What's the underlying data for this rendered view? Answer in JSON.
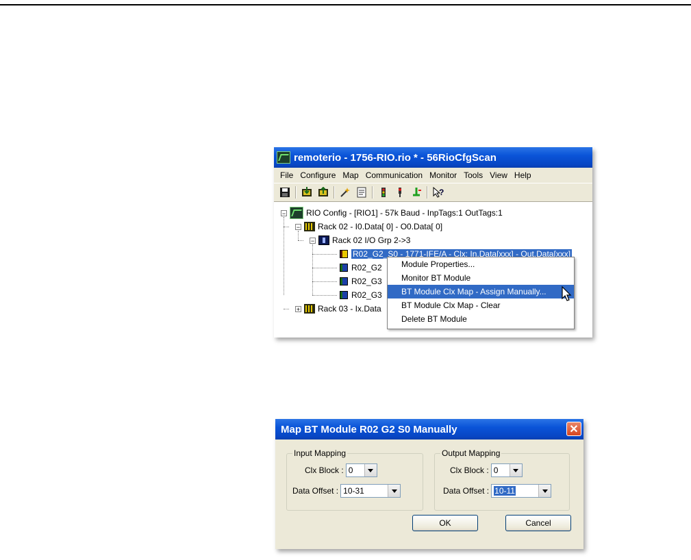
{
  "window1": {
    "title": "remoterio - 1756-RIO.rio * - 56RioCfgScan",
    "menu": [
      "File",
      "Configure",
      "Map",
      "Communication",
      "Monitor",
      "Tools",
      "View",
      "Help"
    ],
    "toolbar_icons": [
      "save-icon",
      "download-icon",
      "upload-icon",
      "wizard-icon",
      "report-icon",
      "monitor-icon",
      "stoplight-icon",
      "connect-icon",
      "help-icon"
    ],
    "tree": {
      "root": "RIO Config - [RIO1] -  57k Baud - InpTags:1 OutTags:1",
      "rack02": "Rack 02 - I0.Data[  0] - O0.Data[  0]",
      "group": "Rack 02 I/O Grp 2->3",
      "modules": [
        {
          "label": "R02_G2_S0 - 1771-IFE/A - Clx: In.Data[xxx] - Out.Data[xxx]",
          "color": "#e8c800"
        },
        {
          "label": "R02_G2",
          "color": "#1c3fa8"
        },
        {
          "label": "R02_G3",
          "color": "#1c3fa8"
        },
        {
          "label": "R02_G3",
          "color": "#1c3fa8"
        }
      ],
      "rack03": "Rack 03 - Ix.Data"
    },
    "context_menu": [
      "Module Properties...",
      "Monitor BT Module",
      "BT Module Clx Map - Assign Manually...",
      "BT Module Clx Map - Clear",
      "Delete BT Module"
    ],
    "context_highlight_index": 2
  },
  "window2": {
    "title": "Map BT Module R02 G2 S0 Manually",
    "input": {
      "legend": "Input Mapping",
      "clx_label": "Clx Block :",
      "clx_value": "0",
      "offset_label": "Data Offset :",
      "offset_value": "10-31"
    },
    "output": {
      "legend": "Output Mapping",
      "clx_label": "Clx Block :",
      "clx_value": "0",
      "offset_label": "Data Offset :",
      "offset_value": "10-11"
    },
    "ok_label": "OK",
    "cancel_label": "Cancel"
  }
}
